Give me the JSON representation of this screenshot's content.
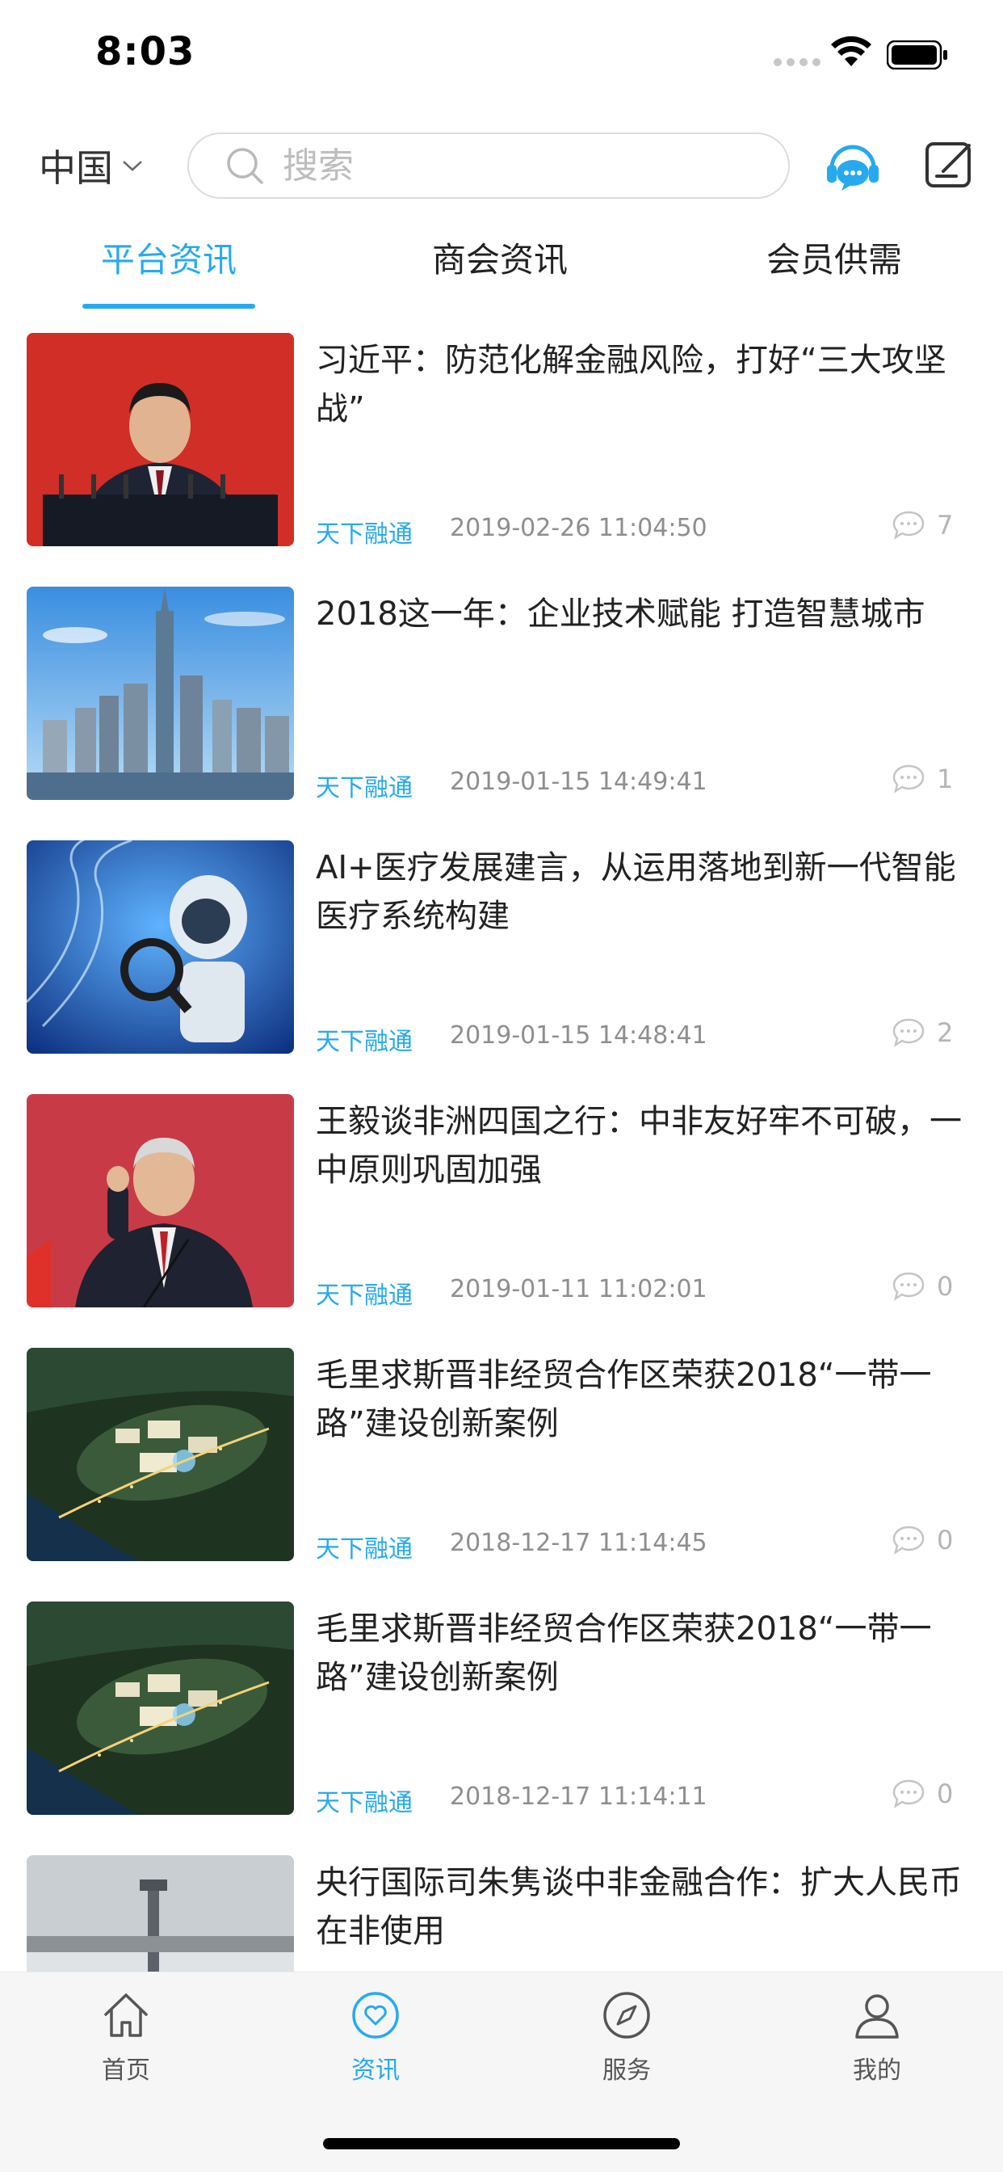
{
  "status_bar": {
    "time": "8:03"
  },
  "header": {
    "region": "中国",
    "search_placeholder": "搜索"
  },
  "tabs": [
    {
      "label": "平台资讯",
      "active": true
    },
    {
      "label": "商会资讯",
      "active": false
    },
    {
      "label": "会员供需",
      "active": false
    }
  ],
  "news": [
    {
      "title": "习近平：防范化解金融风险，打好“三大攻坚战”",
      "source": "天下融通",
      "time": "2019-02-26 11:04:50",
      "comments": "7",
      "thumb": "speech-podium"
    },
    {
      "title": "2018这一年：企业技术赋能 打造智慧城市",
      "source": "天下融通",
      "time": "2019-01-15 14:49:41",
      "comments": "1",
      "thumb": "city-skyline"
    },
    {
      "title": "AI+医疗发展建言，从运用落地到新一代智能医疗系统构建",
      "source": "天下融通",
      "time": "2019-01-15 14:48:41",
      "comments": "2",
      "thumb": "robot-dna"
    },
    {
      "title": "王毅谈非洲四国之行：中非友好牢不可破，一中原则巩固加强",
      "source": "天下融通",
      "time": "2019-01-11 11:02:01",
      "comments": "0",
      "thumb": "speaker-red"
    },
    {
      "title": "毛里求斯晋非经贸合作区荣获2018“一带一路”建设创新案例",
      "source": "天下融通",
      "time": "2018-12-17 11:14:45",
      "comments": "0",
      "thumb": "aerial-night"
    },
    {
      "title": "毛里求斯晋非经贸合作区荣获2018“一带一路”建设创新案例",
      "source": "天下融通",
      "time": "2018-12-17 11:14:11",
      "comments": "0",
      "thumb": "aerial-night"
    },
    {
      "title": "央行国际司朱隽谈中非金融合作：扩大人民币在非使用",
      "source": "",
      "time": "",
      "comments": "",
      "thumb": "tower"
    }
  ],
  "tab_bar": [
    {
      "label": "首页",
      "icon": "home-icon",
      "active": false
    },
    {
      "label": "资讯",
      "icon": "heart-circle-icon",
      "active": true
    },
    {
      "label": "服务",
      "icon": "compass-icon",
      "active": false
    },
    {
      "label": "我的",
      "icon": "user-icon",
      "active": false
    }
  ],
  "colors": {
    "accent": "#27a9f0",
    "text": "#222222",
    "muted": "#8e8e8e"
  }
}
